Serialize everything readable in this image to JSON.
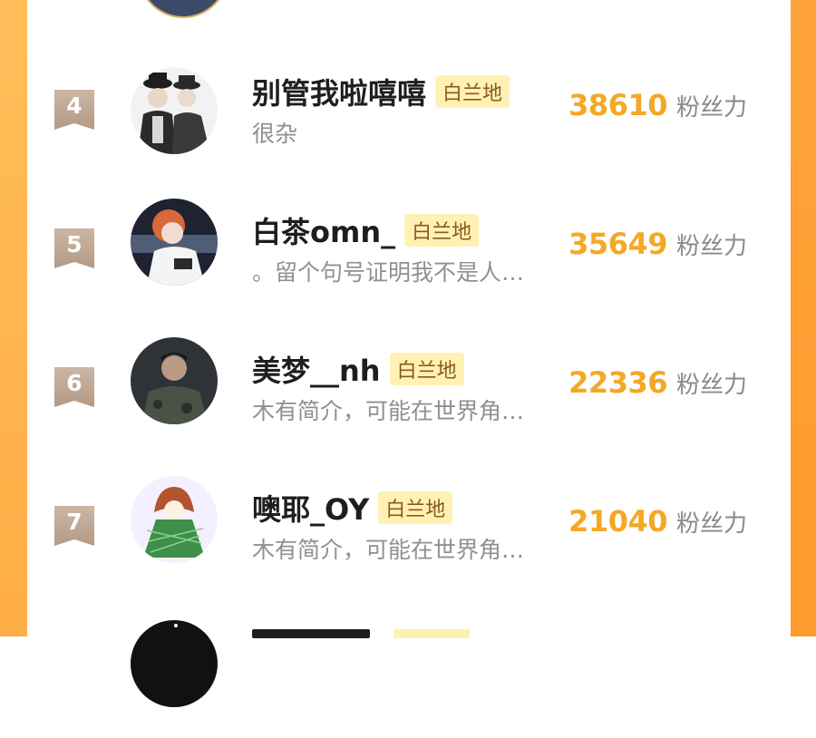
{
  "ranking": {
    "items": [
      {
        "rank": "4",
        "name": "别管我啦嘻嘻",
        "tag": "白兰地",
        "bio": "很杂",
        "score": "38610",
        "score_unit": "粉丝力"
      },
      {
        "rank": "5",
        "name": "白茶omn_",
        "tag": "白兰地",
        "bio": "。留个句号证明我不是人…",
        "score": "35649",
        "score_unit": "粉丝力"
      },
      {
        "rank": "6",
        "name": "美梦__nh",
        "tag": "白兰地",
        "bio": "木有简介，可能在世界角…",
        "score": "22336",
        "score_unit": "粉丝力"
      },
      {
        "rank": "7",
        "name": "噢耶_OY",
        "tag": "白兰地",
        "bio": "木有简介，可能在世界角…",
        "score": "21040",
        "score_unit": "粉丝力"
      }
    ]
  },
  "colors": {
    "accent": "#f4a825",
    "side_bar": "#ffa43a",
    "tag_bg": "#fff1b4",
    "rank_badge": "#c2ab98"
  }
}
